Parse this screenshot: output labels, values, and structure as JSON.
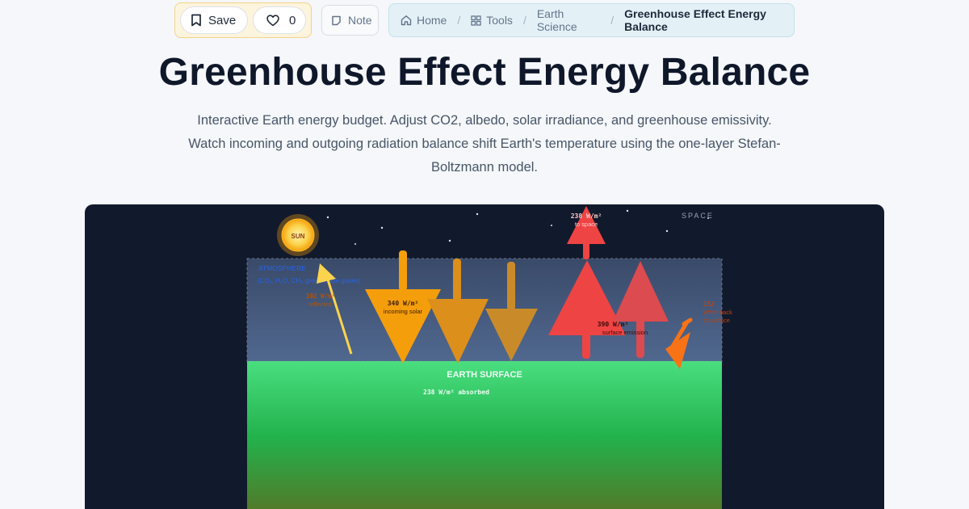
{
  "toolbar": {
    "save_label": "Save",
    "like_count": "0",
    "note_label": "Note"
  },
  "breadcrumb": {
    "items": [
      "Home",
      "Tools",
      "Earth Science",
      "Greenhouse Effect Energy Balance"
    ]
  },
  "page": {
    "title": "Greenhouse Effect Energy Balance",
    "description": "Interactive Earth energy budget. Adjust CO2, albedo, solar irradiance, and greenhouse emissivity. Watch incoming and outgoing radiation balance shift Earth's temperature using the one-layer Stefan-Boltzmann model."
  },
  "simulation": {
    "space_label": "SPACE",
    "sun_label": "SUN",
    "atmosphere_title": "ATMOSPHERE",
    "atmosphere_subtitle": "(CO₂, H₂O, CH₄ greenhouse gases)",
    "surface_label": "EARTH SURFACE",
    "absorbed_label": "238 W/m² absorbed",
    "incoming": {
      "value": "340 W/m²",
      "caption": "incoming solar"
    },
    "reflected": {
      "value": "102 W/m²",
      "caption": "reflected"
    },
    "to_space": {
      "value": "238 W/m²",
      "caption": "to space"
    },
    "surface_emission": {
      "value": "390 W/m²",
      "caption": "surface emission"
    },
    "back_radiation": {
      "value": "152",
      "caption1": "W/m² back",
      "caption2": "to surface"
    },
    "colors": {
      "solar": "#f59e0b",
      "infrared": "#ef4444",
      "back": "#f97316",
      "reflected": "#fcd34d",
      "atmosphere_label": "#2563eb"
    }
  }
}
